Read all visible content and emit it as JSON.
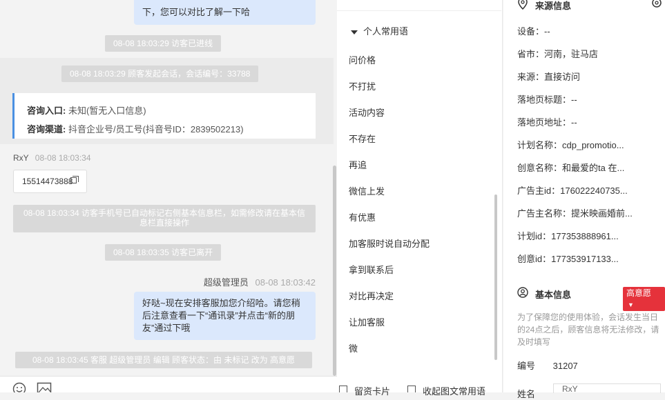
{
  "chat": {
    "top_bubble_text": "下，您可以对比了解一下哈",
    "sys_visitor_in": "08-08 18:03:29 访客已进线",
    "sys_session_start": "08-08 18:03:29 顾客发起会话，会话编号：33788",
    "card": {
      "entry_label": "咨询入口:",
      "entry_value": "未知(暂无入口信息)",
      "channel_label": "咨询渠道:",
      "channel_value": "抖音企业号/员工号(抖音号ID：2839502213)"
    },
    "visitor_name": "RxY",
    "visitor_time": "08-08 18:03:34",
    "phone_message": "15514473888",
    "sys_phone_marked": "08-08 18:03:34 访客手机号已自动标记右侧基本信息栏，如需修改请在基本信息栏直接操作",
    "sys_visitor_left": "08-08 18:03:35 访客已离开",
    "agent_name": "超级管理员",
    "agent_time": "08-08 18:03:42",
    "agent_message": "好哒~现在安排客服加您介绍哈。请您稍后注意查看一下“通讯录”并点击“新的朋友”通过下哦",
    "sys_status_change": "08-08 18:03:45 客服 超级管理员 编辑 顾客状态：由 未标记 改为 高意愿",
    "toolbar_icons": [
      "emoji-icon",
      "image-icon"
    ]
  },
  "phrases": {
    "group_title": "个人常用语",
    "items": [
      "问价格",
      "不打扰",
      "活动内容",
      "不存在",
      "再追",
      "微信上发",
      "有优惠",
      "加客服时说自动分配",
      "拿到联系后",
      "对比再决定",
      "让加客服",
      "微"
    ],
    "footer_card": "留资卡片",
    "footer_common": "收起图文常用语"
  },
  "info": {
    "source_title": "来源信息",
    "source_rows": [
      {
        "label": "设备：",
        "value": "--"
      },
      {
        "label": "省市：",
        "value": "河南，驻马店"
      },
      {
        "label": "来源：",
        "value": "直接访问"
      },
      {
        "label": "落地页标题：",
        "value": "--"
      },
      {
        "label": "落地页地址：",
        "value": "--"
      },
      {
        "label": "计划名称：",
        "value": "cdp_promotio..."
      },
      {
        "label": "创意名称：",
        "value": "和最爱的ta 在..."
      },
      {
        "label": "广告主id：",
        "value": "176022240735..."
      },
      {
        "label": "广告主名称：",
        "value": "提米映画婚前..."
      },
      {
        "label": "计划id：",
        "value": "177353888961..."
      },
      {
        "label": "创意id：",
        "value": "177353917133..."
      }
    ],
    "basic_title": "基本信息",
    "intent_tag": "高意愿",
    "note": "为了保障您的使用体验，会话发生当日的24点之后，顾客信息将无法修改，请及时填写",
    "id_label": "编号",
    "id_value": "31207",
    "name_label": "姓名",
    "name_value": "RxY"
  },
  "colors": {
    "accent_blue": "#4a90e2",
    "bubble_blue": "#dbe8fc",
    "tag_red": "#e5323b",
    "sys_gray": "#d9d9d9"
  }
}
